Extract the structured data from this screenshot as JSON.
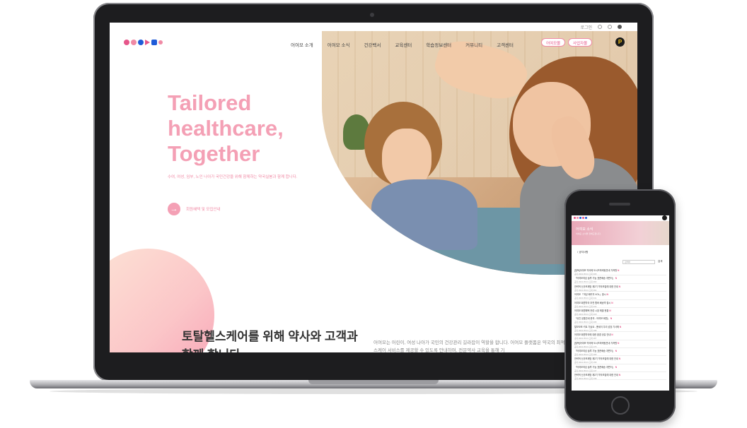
{
  "site": {
    "util": {
      "login": "로그인"
    },
    "nav": {
      "items": [
        "어여모 소개",
        "어여모 소식",
        "건강백서",
        "교육센터",
        "학습정보센터",
        "커뮤니티",
        "고객센터"
      ],
      "pill_primary": "어여모몰",
      "pill_secondary": "사업자몰",
      "badge": "P"
    },
    "hero": {
      "title": "Tailored healthcare, Together",
      "subtitle": "수여, 여성, 임부, 노인 나아가 국민건강을 위해 함께하는 약국실봉과 함께 합니다.",
      "cta": "회원혜택 및 모집안내"
    },
    "intro": {
      "title": "토탈헬스케어를 위해 약사와 고객과 함께 합니다",
      "paragraph": "어여모는 어린이, 여성 나아가 국민의 건강관리 길라잡이 역할을 합니다. 어여모 플랫폼은 약국의 최적의 토탈헬스케어 서비스를 제공할 수 있도록 안내하며, 전문약사 교육을 통해 기"
    }
  },
  "mobile": {
    "banner_title": "어여모 소식",
    "banner_sub": "어여모 소식을 전해드립니다.",
    "breadcrumb": "〈  공지사항",
    "search_placeholder": "검색어",
    "search_button": "검색",
    "rows": [
      {
        "title": "[필독]어여모 약국에 도너츠마케팅안내 가져왔",
        "meta": "공지   2021.05.31   조회 305"
      },
      {
        "title": "「어여모여성 솔루 기능 표준배송 개편이」",
        "meta": "공지   2021.05.31   조회 280"
      },
      {
        "title": "전략적 신규조제방 제2기 약국모집에 대한 안내",
        "meta": "공지   2021.05.31   조회 264"
      },
      {
        "title": "어여모 「여성 패키지 VOL」출시",
        "meta": "공지   2021.05.31   조회 241"
      },
      {
        "title": "어여모 회원약국 추천 멤버 배송약 출시",
        "meta": "공지   2021.05.31   조회 232"
      },
      {
        "title": "어여모 회원혜택 관련 시장 매출 현황",
        "meta": "공지   2021.05.31   조회 218"
      },
      {
        "title": "「쉬진 유통안내 문의 - 어여모 회원」",
        "meta": "공지   2021.05.31   조회 205"
      },
      {
        "title": "탈모보조 키트 기술요 - 폼세이 우리 성장 기사에",
        "meta": "공지   2021.05.31   조회 198"
      },
      {
        "title": "어여모 회원약국에 대한 환경 공유 안내",
        "meta": "공지   2021.05.31   조회 187"
      },
      {
        "title": "[필독]어여모 약국에 도너츠마케팅안내 가져왔",
        "meta": "공지   2021.05.31   조회 176"
      },
      {
        "title": "「어여모여성 솔루 기능 표준배송 개편이」",
        "meta": "공지   2021.05.31   조회 165"
      },
      {
        "title": "전략적 신규조제방 제2기 약국모집에 대한 안내",
        "meta": "공지   2021.05.31   조회 158"
      },
      {
        "title": "「어여모여성 솔루 기능 표준배송 개편이」",
        "meta": "공지   2021.05.31   조회 147"
      },
      {
        "title": "전략적 신규조제방 제2기 약국모집에 대한 안내",
        "meta": "공지   2021.05.31   조회 139"
      }
    ],
    "new_badge": "N"
  },
  "colors": {
    "accent": "#f4a0b5",
    "accent_dark": "#e6568a",
    "brand_blue": "#1f5bd8"
  },
  "icons": [
    "user-icon",
    "cart-icon",
    "globe-icon",
    "arrow-right-icon",
    "home-button"
  ]
}
